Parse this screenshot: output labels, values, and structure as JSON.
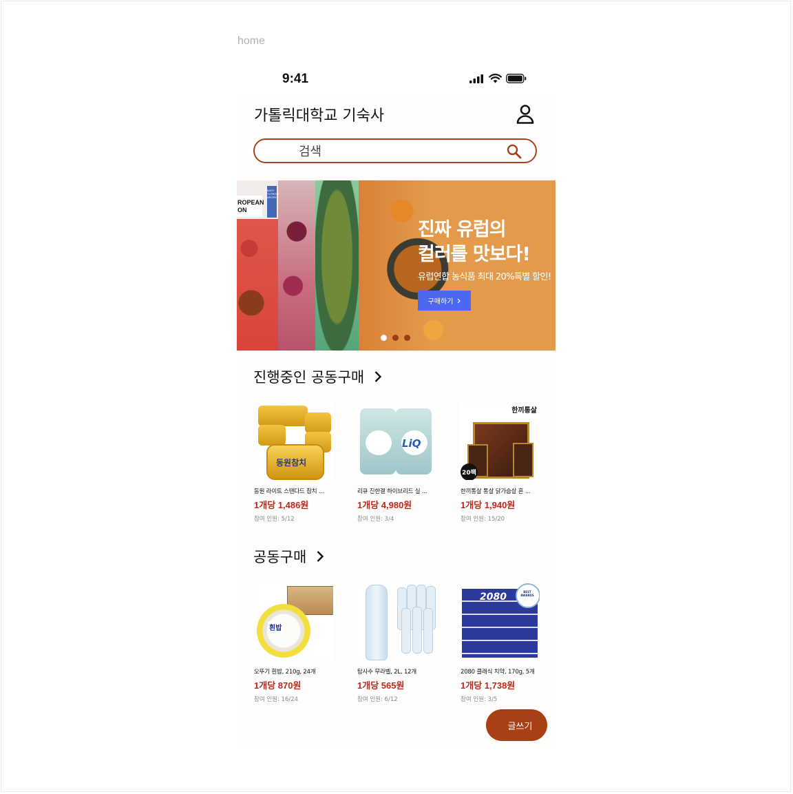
{
  "frame": {
    "label": "home"
  },
  "status_bar": {
    "time": "9:41"
  },
  "header": {
    "title": "가톨릭대학교 기숙사"
  },
  "search": {
    "placeholder": "검색"
  },
  "banner": {
    "title": "진짜 유럽의\n컬러를 맛보다!",
    "subtitle": "유럽연합 농식품 최대 20%특별 할인!",
    "button_label": "구매하기",
    "corner_text_1": "ROPEAN\nON",
    "corner_text_2": "ENJOY\nIT'S FROM\nEUROPE",
    "slides_total": 3,
    "active_slide": 1
  },
  "sections": [
    {
      "title": "진행중인 공동구매",
      "products": [
        {
          "name": "동원 라이트 스탠다드 참치 ...",
          "price": "1개당 1,486원",
          "participants": "참여 인원: 5/12",
          "image_text": "동원참치"
        },
        {
          "name": "리큐 진한겔 하이브리드 실 ...",
          "price": "1개당 4,980원",
          "participants": "참여 인원: 3/4",
          "image_text": "LiQ"
        },
        {
          "name": "한끼통살 통살 닭가슴살 혼 ...",
          "price": "1개당 1,940원",
          "participants": "참여 인원: 15/20",
          "image_text": "한끼통살",
          "badge": "20팩"
        }
      ]
    },
    {
      "title": "공동구매",
      "products": [
        {
          "name": "오뚜기 흰밥, 210g, 24개",
          "price": "1개당 870원",
          "participants": "참여 인원: 16/24",
          "image_text": "흰밥"
        },
        {
          "name": "탐사수 무라벨, 2L, 12개",
          "price": "1개당 565원",
          "participants": "참여 인원: 6/12",
          "image_text": ""
        },
        {
          "name": "2080 클래식 치약, 170g, 5개",
          "price": "1개당 1,738원",
          "participants": "참여 인원: 3/5",
          "image_text": "2080",
          "badge": "BEST AWARDS"
        }
      ]
    }
  ],
  "fab": {
    "label": "글쓰기"
  },
  "colors": {
    "accent": "#a93f15",
    "price": "#c0271a",
    "banner_bg": "#e39a4b",
    "banner_button": "#4c68f0"
  },
  "icons": [
    "signal-icon",
    "wifi-icon",
    "battery-icon",
    "user-icon",
    "search-icon",
    "chevron-right-icon"
  ]
}
